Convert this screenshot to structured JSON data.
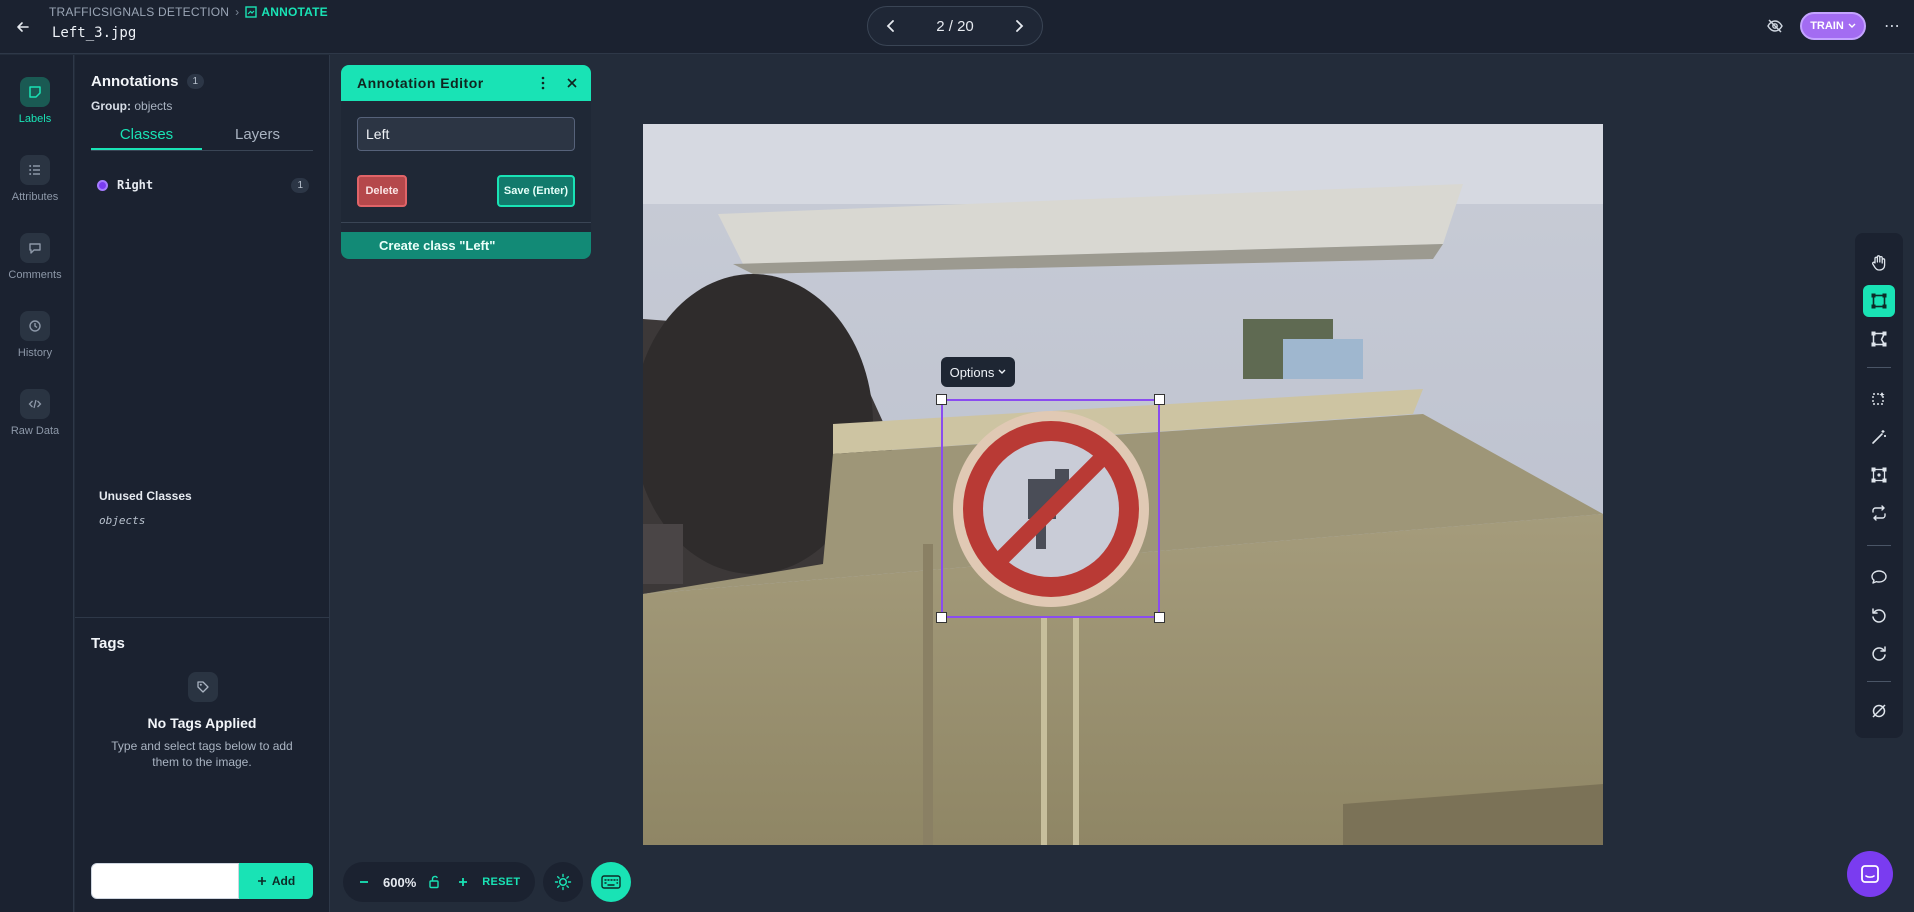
{
  "header": {
    "breadcrumb_project": "TRAFFICSIGNALS DETECTION",
    "breadcrumb_separator": "›",
    "breadcrumb_current": "ANNOTATE",
    "filename": "Left_3.jpg",
    "pager": "2 / 20",
    "train_label": "TRAIN",
    "more": "⋯"
  },
  "rail": {
    "items": [
      {
        "label": "Labels",
        "icon": "label-icon",
        "active": true
      },
      {
        "label": "Attributes",
        "icon": "list-icon",
        "active": false
      },
      {
        "label": "Comments",
        "icon": "comment-icon",
        "active": false
      },
      {
        "label": "History",
        "icon": "history-icon",
        "active": false
      },
      {
        "label": "Raw Data",
        "icon": "code-icon",
        "active": false
      }
    ]
  },
  "annotations": {
    "title": "Annotations",
    "count": "1",
    "group_label": "Group:",
    "group_value": "objects",
    "tabs": [
      {
        "label": "Classes",
        "active": true
      },
      {
        "label": "Layers",
        "active": false
      }
    ],
    "classes": [
      {
        "name": "Right",
        "count": "1",
        "color": "#7a3cf0"
      }
    ],
    "unused_title": "Unused Classes",
    "unused_items": [
      "objects"
    ]
  },
  "tags": {
    "title": "Tags",
    "empty_title": "No Tags Applied",
    "empty_sub": "Type and select tags below to add them to the image.",
    "add_label": "Add",
    "input_value": ""
  },
  "editor": {
    "title": "Annotation Editor",
    "input_value": "Left",
    "delete_label": "Delete",
    "save_label": "Save (Enter)",
    "create_label": "Create class \"Left\""
  },
  "canvas": {
    "options_label": "Options"
  },
  "zoom": {
    "value": "600%",
    "reset_label": "RESET"
  },
  "colors": {
    "accent": "#19e3b5",
    "purple": "#7a3cf0",
    "bg": "#232c3a"
  }
}
